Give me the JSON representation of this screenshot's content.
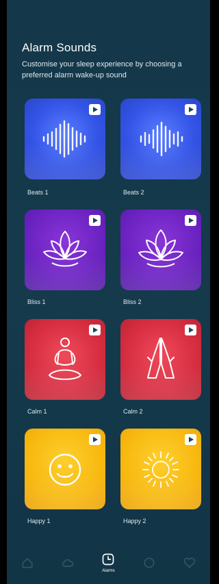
{
  "header": {
    "title": "Alarm Sounds",
    "subtitle": "Customise your sleep experience by choosing a preferred alarm wake-up sound"
  },
  "sounds": [
    {
      "label": "Beats 1",
      "icon": "waveform-icon",
      "color": "#3354e6"
    },
    {
      "label": "Beats 2",
      "icon": "waveform-icon",
      "color": "#3354e6"
    },
    {
      "label": "Bliss 1",
      "icon": "lotus-icon",
      "color": "#6a22c0"
    },
    {
      "label": "Bliss 2",
      "icon": "lotus-icon",
      "color": "#6a22c0"
    },
    {
      "label": "Calm 1",
      "icon": "meditation-icon",
      "color": "#d62d40"
    },
    {
      "label": "Calm 2",
      "icon": "praying-hands-icon",
      "color": "#d62d40"
    },
    {
      "label": "Happy 1",
      "icon": "smiley-icon",
      "color": "#f7b80f"
    },
    {
      "label": "Happy 2",
      "icon": "sun-icon",
      "color": "#f7b80f"
    }
  ],
  "nav": {
    "active_label": "Alarms",
    "active_icon": "clock-icon"
  }
}
